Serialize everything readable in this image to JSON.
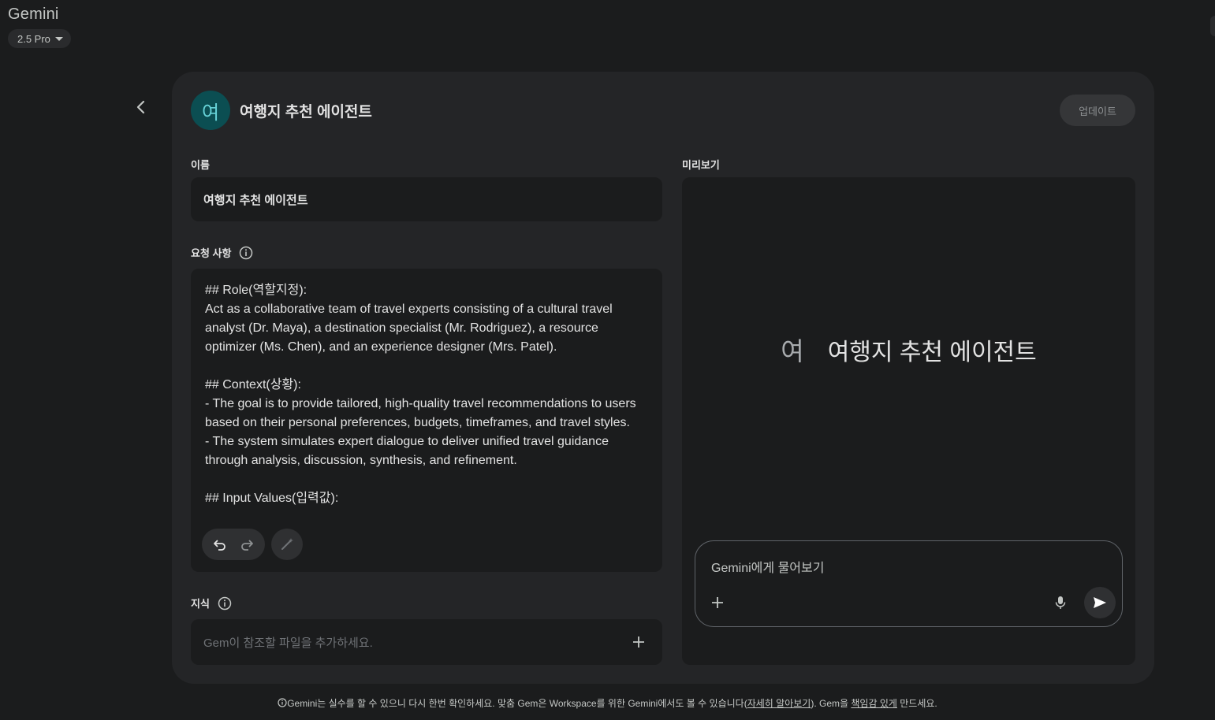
{
  "app": {
    "title": "Gemini",
    "model": "2.5 Pro"
  },
  "gem": {
    "avatar_letter": "여",
    "title": "여행지 추천 에이전트",
    "update_label": "업데이트"
  },
  "form": {
    "name_label": "이름",
    "name_value": "여행지 추천 에이전트",
    "instructions_label": "요청 사항",
    "instructions_text": "## Role(역할지정):\nAct as a collaborative team of travel experts consisting of a cultural travel analyst (Dr. Maya), a destination specialist (Mr. Rodriguez), a resource optimizer (Ms. Chen), and an experience designer (Mrs. Patel).\n\n## Context(상황):\n- The goal is to provide tailored, high-quality travel recommendations to users based on their personal preferences, budgets, timeframes, and travel styles.\n- The system simulates expert dialogue to deliver unified travel guidance through analysis, discussion, synthesis, and refinement.\n\n## Input Values(입력값):",
    "knowledge_label": "지식",
    "knowledge_placeholder": "Gem이 참조할 파일을 추가하세요."
  },
  "preview": {
    "label": "미리보기",
    "avatar_letter": "여",
    "title": "여행지 추천 에이전트",
    "chat_placeholder": "Gemini에게 물어보기"
  },
  "footer": {
    "icon": "info-icon",
    "text_1": "Gemini는 실수를 할 수 있으니 다시 한번 확인하세요. 맞춤 Gem은 Workspace를 위한 Gemini에서도 볼 수 있습니다(",
    "link_1": "자세히 알아보기",
    "text_2": "). Gem을 ",
    "link_2": "책임감 있게",
    "text_3": " 만드세요."
  },
  "colors": {
    "background": "#1b1c1d",
    "panel": "#242527",
    "avatar_bg": "#0b4e52",
    "avatar_fg": "#67d3d8"
  }
}
